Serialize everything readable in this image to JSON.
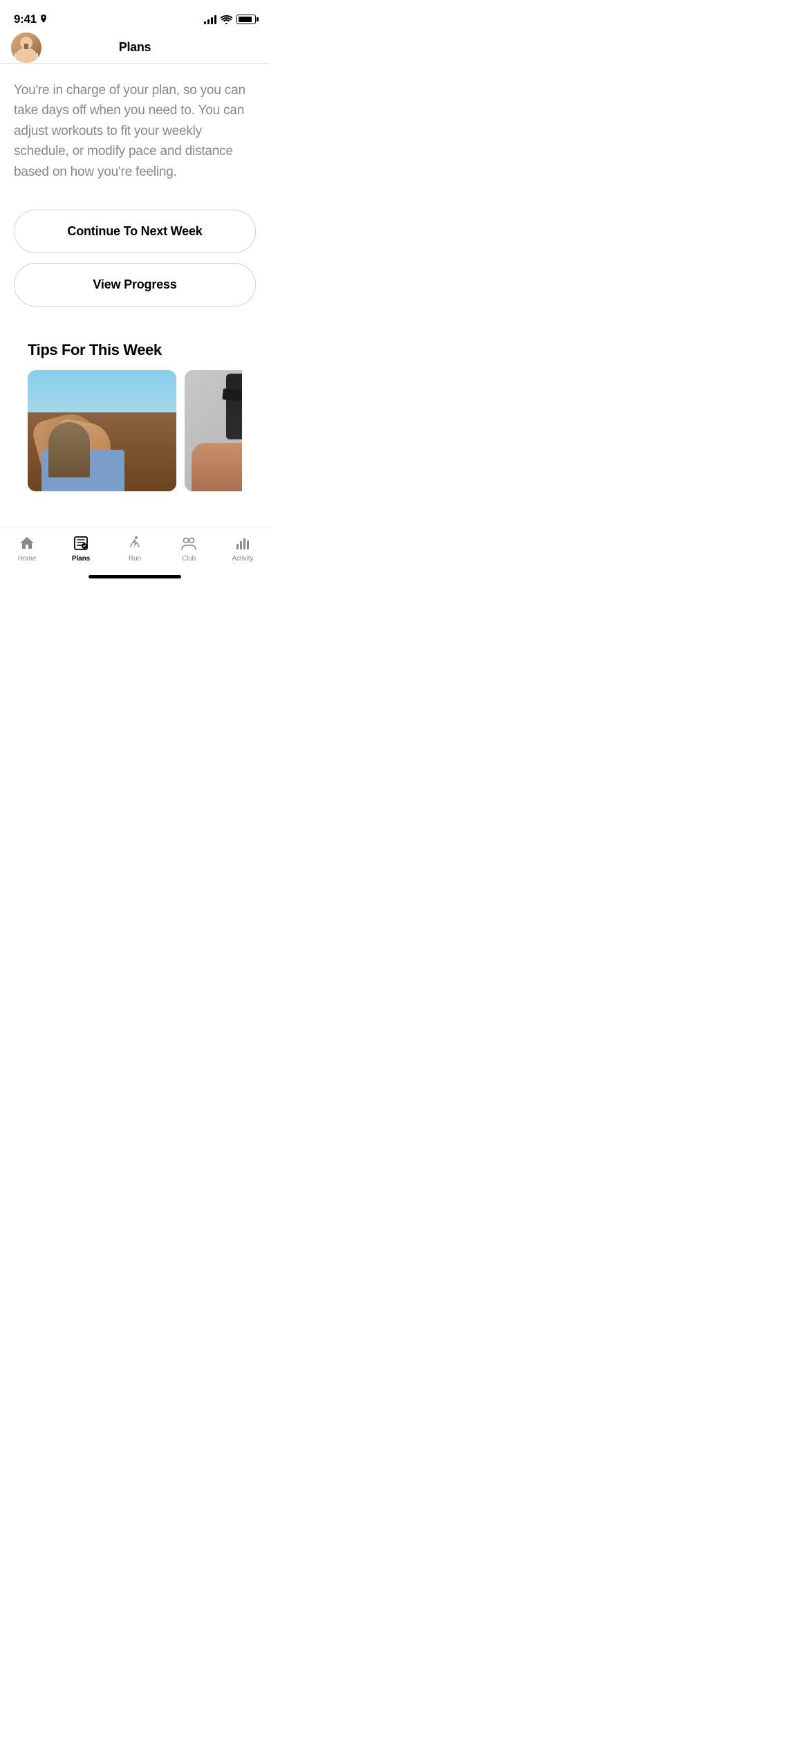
{
  "statusBar": {
    "time": "9:41",
    "hasLocation": true
  },
  "header": {
    "title": "Plans"
  },
  "main": {
    "description": "You're in charge of your plan, so you can take days off when you need to. You can adjust workouts to fit your weekly schedule, or modify pace and distance based on how you're feeling.",
    "buttons": [
      {
        "id": "continue-next-week",
        "label": "Continue To Next Week"
      },
      {
        "id": "view-progress",
        "label": "View Progress"
      }
    ],
    "tipsSection": {
      "title": "Tips For This Week"
    }
  },
  "bottomNav": {
    "items": [
      {
        "id": "home",
        "label": "Home",
        "active": false
      },
      {
        "id": "plans",
        "label": "Plans",
        "active": true
      },
      {
        "id": "run",
        "label": "Run",
        "active": false
      },
      {
        "id": "club",
        "label": "Club",
        "active": false
      },
      {
        "id": "activity",
        "label": "Activity",
        "active": false
      }
    ]
  }
}
